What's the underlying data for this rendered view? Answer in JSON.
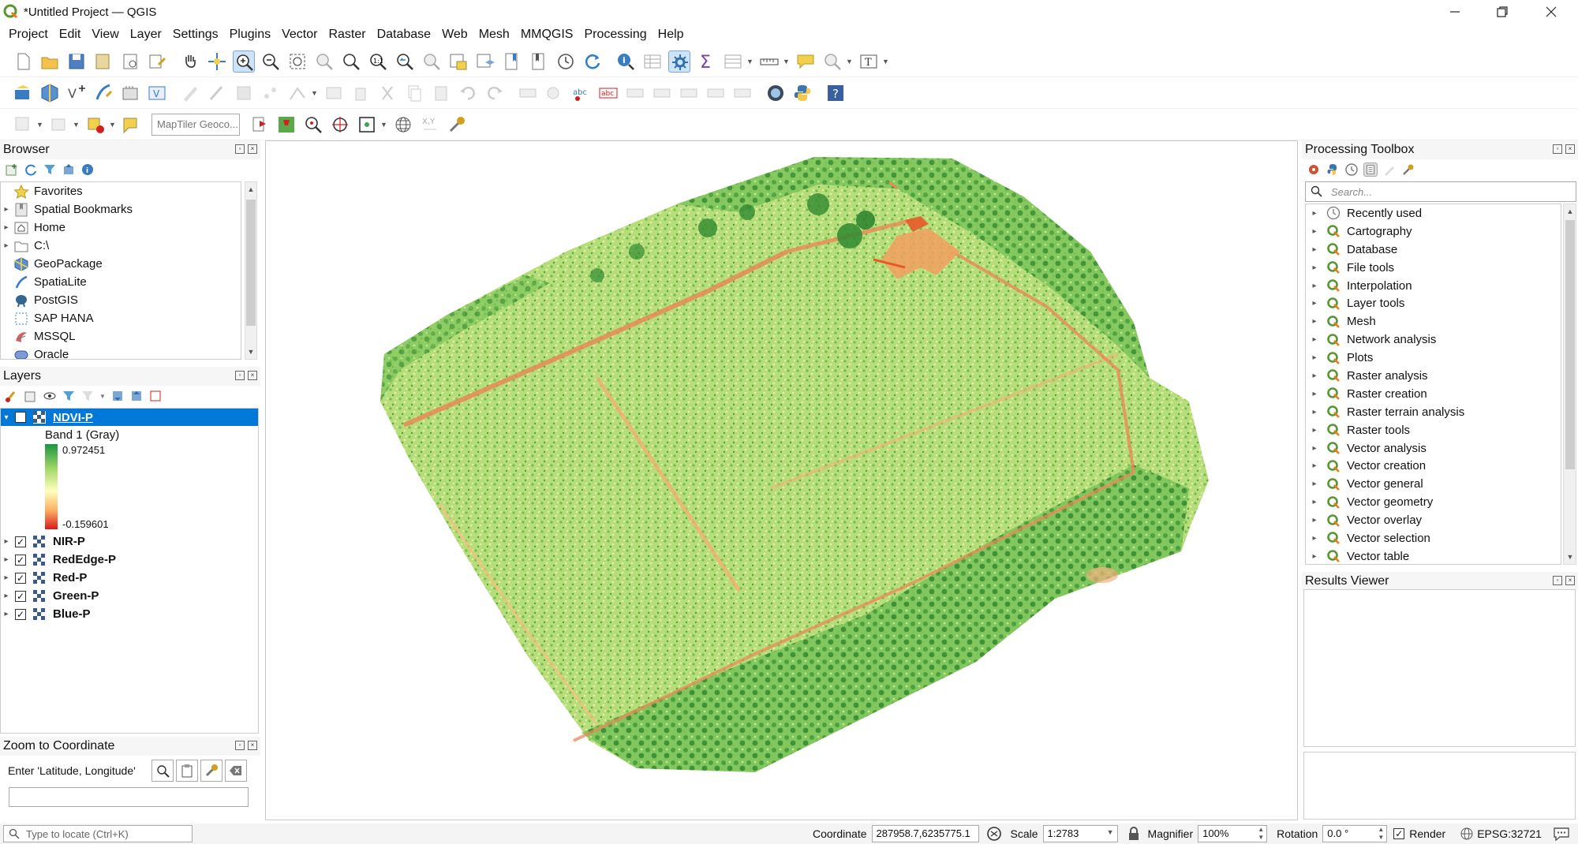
{
  "window": {
    "title": "*Untitled Project — QGIS",
    "controls": [
      "minimize",
      "restore",
      "close"
    ]
  },
  "menubar": {
    "items": [
      {
        "label": "Project"
      },
      {
        "label": "Edit"
      },
      {
        "label": "View"
      },
      {
        "label": "Layer"
      },
      {
        "label": "Settings"
      },
      {
        "label": "Plugins"
      },
      {
        "label": "Vector"
      },
      {
        "label": "Raster"
      },
      {
        "label": "Database"
      },
      {
        "label": "Web"
      },
      {
        "label": "Mesh"
      },
      {
        "label": "MMQGIS"
      },
      {
        "label": "Processing"
      },
      {
        "label": "Help"
      }
    ]
  },
  "toolbar3": {
    "geocoder_placeholder": "MapTiler Geoco..."
  },
  "browser": {
    "title": "Browser",
    "items": [
      {
        "label": "Favorites",
        "icon": "star-icon",
        "expandable": false
      },
      {
        "label": "Spatial Bookmarks",
        "icon": "bookmark-icon",
        "expandable": true
      },
      {
        "label": "Home",
        "icon": "home-icon",
        "expandable": true
      },
      {
        "label": "C:\\",
        "icon": "drive-icon",
        "expandable": true
      },
      {
        "label": "GeoPackage",
        "icon": "geopackage-icon",
        "expandable": false
      },
      {
        "label": "SpatiaLite",
        "icon": "spatialite-icon",
        "expandable": false
      },
      {
        "label": "PostGIS",
        "icon": "postgis-icon",
        "expandable": false
      },
      {
        "label": "SAP HANA",
        "icon": "sap-hana-icon",
        "expandable": false
      },
      {
        "label": "MSSQL",
        "icon": "mssql-icon",
        "expandable": false
      },
      {
        "label": "Oracle",
        "icon": "oracle-icon",
        "expandable": false
      }
    ]
  },
  "layers": {
    "title": "Layers",
    "active_layer": {
      "name": "NDVI-P",
      "checked": true,
      "band_label": "Band 1 (Gray)",
      "legend_max": "0.972451",
      "legend_min": "-0.159601"
    },
    "items": [
      {
        "name": "NIR-P",
        "checked": true
      },
      {
        "name": "RedEdge-P",
        "checked": true
      },
      {
        "name": "Red-P",
        "checked": true
      },
      {
        "name": "Green-P",
        "checked": true
      },
      {
        "name": "Blue-P",
        "checked": true
      }
    ]
  },
  "zoom_to_coordinate": {
    "title": "Zoom to Coordinate",
    "label": "Enter 'Latitude, Longitude'",
    "value": ""
  },
  "processing": {
    "title": "Processing Toolbox",
    "search_placeholder": "Search...",
    "items": [
      {
        "label": "Recently used",
        "icon": "clock-icon"
      },
      {
        "label": "Cartography",
        "icon": "qgis-icon"
      },
      {
        "label": "Database",
        "icon": "qgis-icon"
      },
      {
        "label": "File tools",
        "icon": "qgis-icon"
      },
      {
        "label": "Interpolation",
        "icon": "qgis-icon"
      },
      {
        "label": "Layer tools",
        "icon": "qgis-icon"
      },
      {
        "label": "Mesh",
        "icon": "qgis-icon"
      },
      {
        "label": "Network analysis",
        "icon": "qgis-icon"
      },
      {
        "label": "Plots",
        "icon": "qgis-icon"
      },
      {
        "label": "Raster analysis",
        "icon": "qgis-icon"
      },
      {
        "label": "Raster creation",
        "icon": "qgis-icon"
      },
      {
        "label": "Raster terrain analysis",
        "icon": "qgis-icon"
      },
      {
        "label": "Raster tools",
        "icon": "qgis-icon"
      },
      {
        "label": "Vector analysis",
        "icon": "qgis-icon"
      },
      {
        "label": "Vector creation",
        "icon": "qgis-icon"
      },
      {
        "label": "Vector general",
        "icon": "qgis-icon"
      },
      {
        "label": "Vector geometry",
        "icon": "qgis-icon"
      },
      {
        "label": "Vector overlay",
        "icon": "qgis-icon"
      },
      {
        "label": "Vector selection",
        "icon": "qgis-icon"
      },
      {
        "label": "Vector table",
        "icon": "qgis-icon"
      }
    ]
  },
  "results_viewer": {
    "title": "Results Viewer"
  },
  "statusbar": {
    "locator_placeholder": "Type to locate (Ctrl+K)",
    "coordinate_label": "Coordinate",
    "coordinate_value": "287958.7,6235775.1",
    "scale_label": "Scale",
    "scale_value": "1:2783",
    "magnifier_label": "Magnifier",
    "magnifier_value": "100%",
    "rotation_label": "Rotation",
    "rotation_value": "0.0 °",
    "render_label": "Render",
    "render_checked": true,
    "crs": "EPSG:32721"
  },
  "colors": {
    "selection": "#0078d7",
    "ndvi_high": "#1a9641",
    "ndvi_mid": "#ffffbf",
    "ndvi_low": "#d7191c"
  }
}
